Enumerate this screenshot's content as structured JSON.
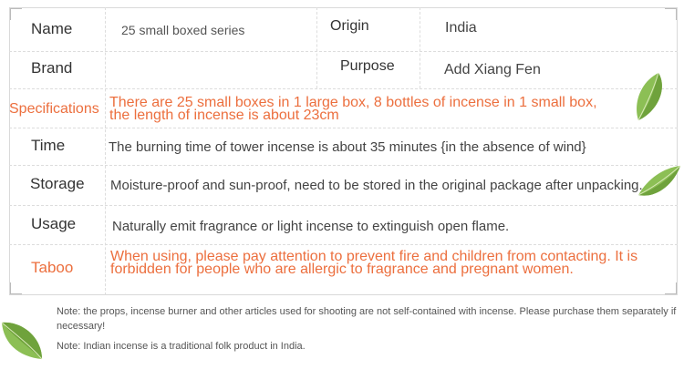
{
  "table": {
    "rows": [
      {
        "label": "Name",
        "value": "25 small boxed series",
        "label2": "Origin",
        "value2": "India"
      },
      {
        "label": "Brand",
        "value": "",
        "label2": "Purpose",
        "value2": "Add Xiang Fen"
      },
      {
        "label": "Specifications",
        "line1": "There are 25 small boxes in 1 large box, 8 bottles of incense in 1 small box,",
        "line2": "the length of incense is about 23cm"
      },
      {
        "label": "Time",
        "value": "The burning time of tower incense is about 35 minutes {in the absence of wind}"
      },
      {
        "label": "Storage",
        "value": "Moisture-proof and sun-proof, need to be stored in the original package after unpacking."
      },
      {
        "label": "Usage",
        "value": "Naturally emit fragrance or light incense to extinguish open flame."
      },
      {
        "label": "Taboo",
        "line1": "When using, please pay attention to prevent fire and children from contacting. It is",
        "line2": "forbidden for people who are allergic to fragrance and pregnant women."
      }
    ]
  },
  "notes": [
    "Note: the props, incense burner and other articles used for shooting are not self-contained with incense. Please purchase them separately if necessary!",
    "Note: Indian incense is a traditional folk product in India."
  ],
  "colors": {
    "accent": "#ec6f3e",
    "leaf": "#7fb24a"
  }
}
